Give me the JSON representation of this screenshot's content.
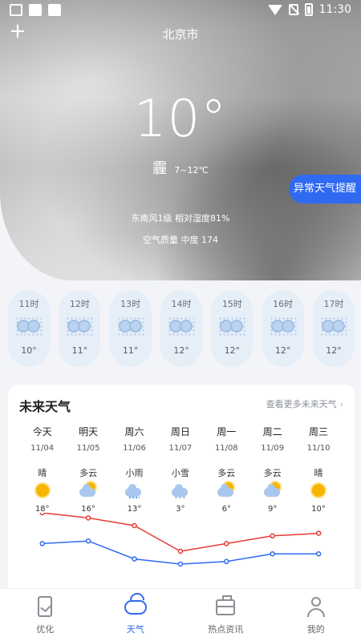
{
  "status_bar": {
    "time": "11:30"
  },
  "header": {
    "add_icon": "plus-icon",
    "city": "北京市"
  },
  "current": {
    "temperature": "10°",
    "condition": "霾",
    "range": "7~12℃",
    "wind_humidity": "东南风1级  相对湿度81%",
    "air_quality": "空气质量 中度 174",
    "alert_button": "异常天气提醒"
  },
  "hourly": [
    {
      "time": "11时",
      "icon": "fog-icon",
      "temp": "10°"
    },
    {
      "time": "12时",
      "icon": "fog-icon",
      "temp": "11°"
    },
    {
      "time": "13时",
      "icon": "fog-icon",
      "temp": "11°"
    },
    {
      "time": "14时",
      "icon": "fog-icon",
      "temp": "12°"
    },
    {
      "time": "15时",
      "icon": "fog-icon",
      "temp": "12°"
    },
    {
      "time": "16时",
      "icon": "fog-icon",
      "temp": "12°"
    },
    {
      "time": "17时",
      "icon": "fog-icon",
      "temp": "12°"
    }
  ],
  "forecast": {
    "title": "未来天气",
    "more_link": "查看更多未来天气",
    "days": [
      {
        "name": "今天",
        "date": "11/04",
        "condition": "晴",
        "icon": "sun-icon",
        "high": "18°"
      },
      {
        "name": "明天",
        "date": "11/05",
        "condition": "多云",
        "icon": "cloud-sun-icon",
        "high": "16°"
      },
      {
        "name": "周六",
        "date": "11/06",
        "condition": "小雨",
        "icon": "light-rain-icon",
        "high": "13°"
      },
      {
        "name": "周日",
        "date": "11/07",
        "condition": "小雪",
        "icon": "light-snow-icon",
        "high": "3°"
      },
      {
        "name": "周一",
        "date": "11/08",
        "condition": "多云",
        "icon": "cloud-sun-icon",
        "high": "6°"
      },
      {
        "name": "周二",
        "date": "11/09",
        "condition": "多云",
        "icon": "cloud-sun-icon",
        "high": "9°"
      },
      {
        "name": "周三",
        "date": "11/10",
        "condition": "晴",
        "icon": "sun-icon",
        "high": "10°"
      }
    ],
    "high_values": [
      18,
      16,
      13,
      3,
      6,
      9,
      10
    ],
    "low_values": [
      6,
      7,
      0,
      -2,
      -1,
      2,
      2
    ],
    "high_color": "#e53935",
    "low_color": "#2f6af0"
  },
  "bottom_nav": [
    {
      "label": "优化",
      "icon": "phone-optimize-icon",
      "active": false
    },
    {
      "label": "天气",
      "icon": "cloud-icon",
      "active": true
    },
    {
      "label": "热点资讯",
      "icon": "news-briefcase-icon",
      "active": false
    },
    {
      "label": "我的",
      "icon": "user-icon",
      "active": false
    }
  ]
}
